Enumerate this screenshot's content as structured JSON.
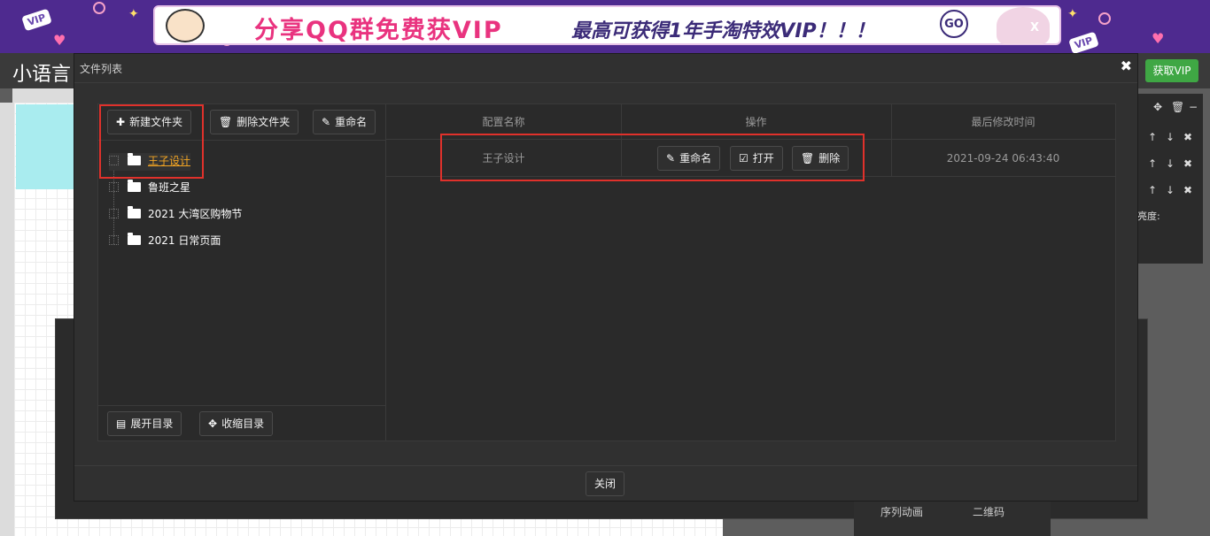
{
  "banner": {
    "text": "分享QQ群免费获VIP",
    "subtext": "最高可获得1年手淘特效VIP！！！",
    "go": "GO",
    "close": "X",
    "vip_ticket": "VIP"
  },
  "app": {
    "logo": "小语言",
    "vip_button": "获取VIP"
  },
  "right_panel": {
    "label": "亮度:"
  },
  "bottom_panel": {
    "item1": "序列动画",
    "item2": "二维码"
  },
  "modal": {
    "title": "文件列表",
    "close_icon": "✖",
    "toolbar": {
      "new_folder": "新建文件夹",
      "delete_folder": "删除文件夹",
      "rename": "重命名"
    },
    "tree": [
      {
        "label": "王子设计",
        "active": true
      },
      {
        "label": "鲁班之星",
        "active": false
      },
      {
        "label": "2021 大湾区购物节",
        "active": false
      },
      {
        "label": "2021 日常页面",
        "active": false
      }
    ],
    "tree_footer": {
      "expand": "展开目录",
      "collapse": "收缩目录"
    },
    "table": {
      "headers": [
        "配置名称",
        "操作",
        "最后修改时间"
      ],
      "rows": [
        {
          "name": "王子设计",
          "actions": {
            "rename": "重命名",
            "open": "打开",
            "delete": "删除"
          },
          "modified": "2021-09-24 06:43:40"
        }
      ]
    },
    "footer": {
      "close": "关闭"
    }
  }
}
